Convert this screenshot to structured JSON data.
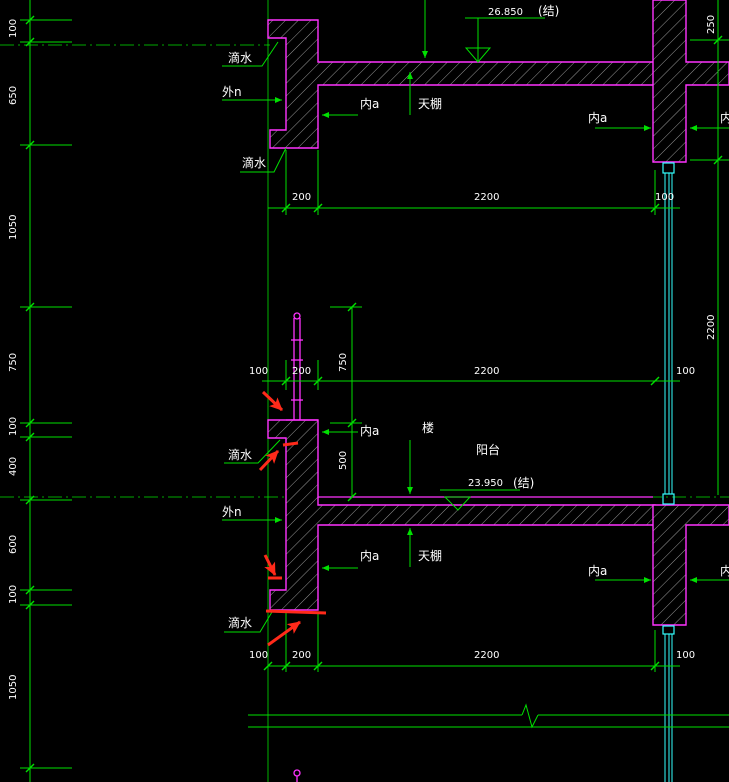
{
  "drawing": {
    "colors": {
      "background": "#000000",
      "dimension_line": "#00e000",
      "wall_outline": "#ff33ff",
      "hatch": "#bbbbbb",
      "window": "#33ffff",
      "text": "#ffffff",
      "markup": "#ff2a1a"
    },
    "elevations": {
      "top": "26.850",
      "top_suffix": "(结)",
      "middle": "23.950",
      "middle_suffix": "(结)"
    },
    "left_dims": {
      "d1": "100",
      "d2": "650",
      "d3": "1050",
      "d4": "750",
      "d5": "100",
      "d6": "400",
      "d7": "600",
      "d8": "100",
      "d9": "1050"
    },
    "right_dims": {
      "top": "250",
      "tall": "2200"
    },
    "span_dims": {
      "w1": "200",
      "w1_span": "2200",
      "w1_right": "100",
      "w2_left": "100",
      "w2": "200",
      "w2_span": "2200",
      "w2_right": "100",
      "rail_height": "750",
      "parapet_height": "500",
      "w3_left": "100",
      "w3": "200",
      "w3_span": "2200",
      "w3_right": "100"
    },
    "notes": {
      "drip_1": "滴水",
      "exterior_1": "外n",
      "drip_2": "滴水",
      "interior_1": "内a",
      "ceiling_1": "天棚",
      "interior_right_1": "内a",
      "interior_edge_1": "内",
      "drip_3": "滴水",
      "exterior_2": "外n",
      "interior_2": "内a",
      "floor_note": "楼",
      "balcony": "阳台",
      "interior_3": "内a",
      "ceiling_2": "天棚",
      "interior_right_2": "内a",
      "interior_edge_2": "内",
      "drip_4": "滴水"
    }
  }
}
